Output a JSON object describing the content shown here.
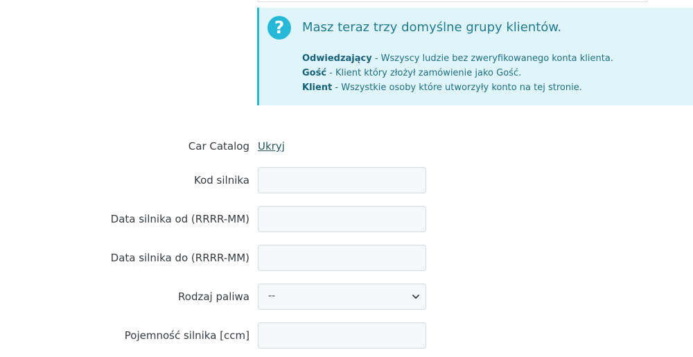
{
  "alert": {
    "icon": "question-icon",
    "icon_glyph": "?",
    "title": "Masz teraz trzy domyślne grupy klientów.",
    "groups": [
      {
        "name": "Odwiedzający",
        "description": " - Wszyscy ludzie bez zweryfikowanego konta klienta."
      },
      {
        "name": "Gość",
        "description": " - Klient który złożył zamówienie jako Gość."
      },
      {
        "name": "Klient",
        "description": " - Wszystkie osoby które utworzyły konto na tej stronie."
      }
    ],
    "colors": {
      "accent": "#25b9d7",
      "background": "#dff5f9"
    }
  },
  "form": {
    "car_catalog": {
      "label": "Car Catalog",
      "toggle_label": "Ukryj"
    },
    "engine_code": {
      "label": "Kod silnika",
      "value": ""
    },
    "engine_date_from": {
      "label": "Data silnika od (RRRR-MM)",
      "value": ""
    },
    "engine_date_to": {
      "label": "Data silnika do (RRRR-MM)",
      "value": ""
    },
    "fuel_type": {
      "label": "Rodzaj paliwa",
      "selected": "--",
      "icon": "chevron-down-icon"
    },
    "engine_capacity": {
      "label": "Pojemność silnika [ccm]",
      "value": ""
    }
  }
}
